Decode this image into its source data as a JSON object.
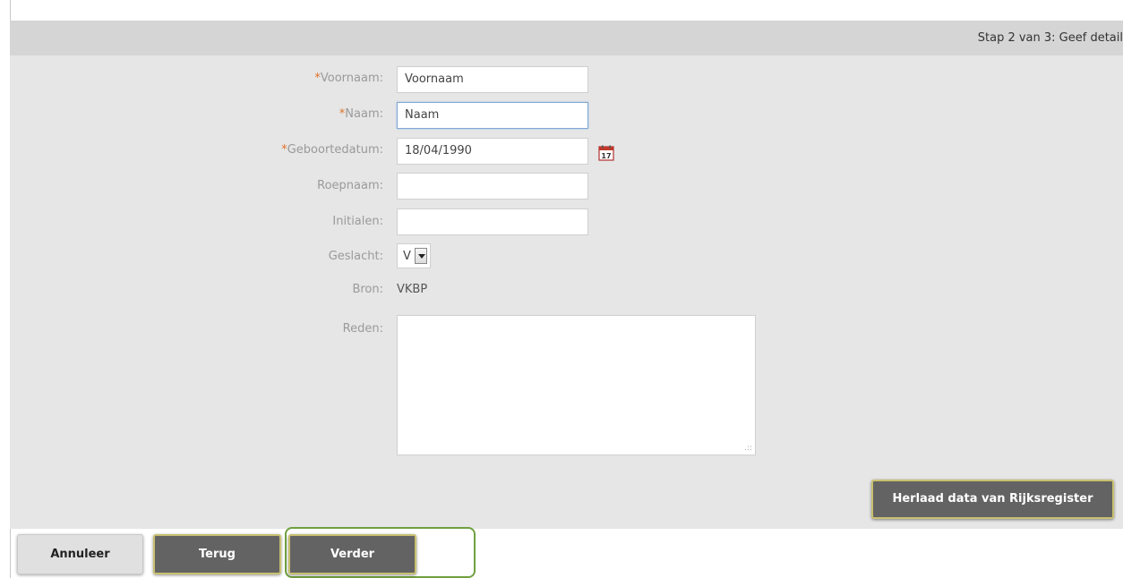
{
  "header": {
    "step_title": "Stap 2 van 3: Geef detail"
  },
  "form": {
    "required_marker": "*",
    "first_name": {
      "label": "Voornaam:",
      "value": "Voornaam"
    },
    "last_name": {
      "label": "Naam:",
      "value": "Naam"
    },
    "birth_date": {
      "label": "Geboortedatum:",
      "value": "18/04/1990",
      "calendar_day": "17"
    },
    "nickname": {
      "label": "Roepnaam:",
      "value": ""
    },
    "initials": {
      "label": "Initialen:",
      "value": ""
    },
    "gender": {
      "label": "Geslacht:",
      "value": "V"
    },
    "source": {
      "label": "Bron:",
      "value": "VKBP"
    },
    "reason": {
      "label": "Reden:",
      "value": ""
    }
  },
  "actions": {
    "reload_label": "Herlaad data van Rijksregister",
    "cancel_label": "Annuleer",
    "back_label": "Terug",
    "next_label": "Verder"
  },
  "colors": {
    "required": "#e0722a",
    "header_bg": "#d5d5d5",
    "form_bg": "#e6e6e6",
    "button_dark": "#636363",
    "highlight": "#6fa040"
  },
  "icons": {
    "date_picker": "calendar-icon",
    "dropdown": "chevron-down-icon",
    "resize": "resize-grip-icon"
  }
}
